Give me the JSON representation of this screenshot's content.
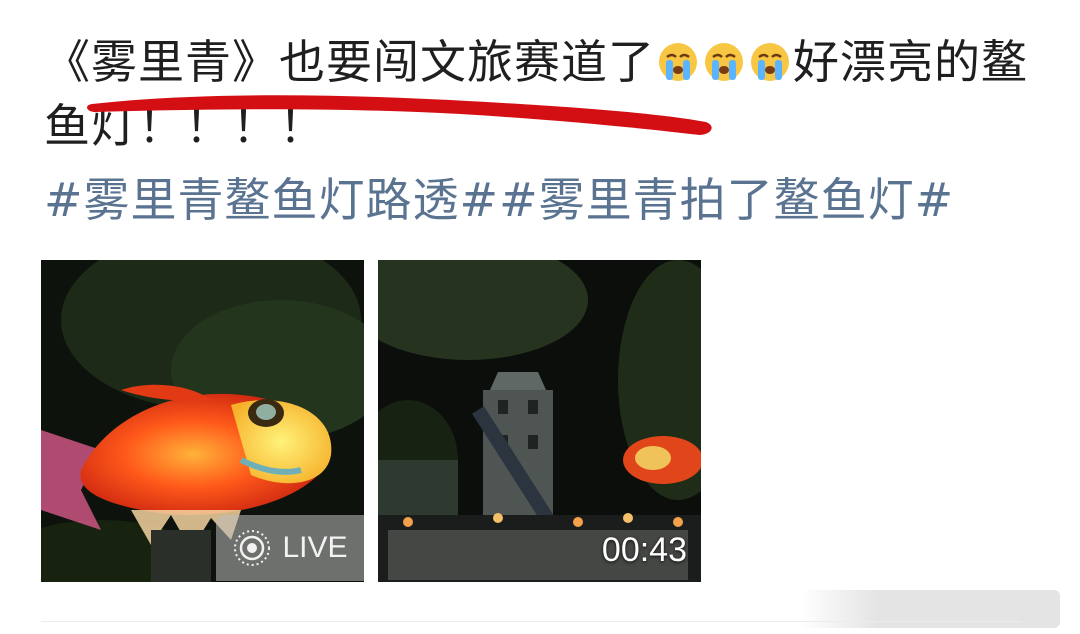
{
  "post": {
    "text_part1": "《雾里青》也要闯文旅赛道了",
    "emoji_icons": [
      "loudly-crying-face-icon",
      "loudly-crying-face-icon",
      "loudly-crying-face-icon"
    ],
    "text_part2": "好漂亮的鳌鱼灯！！！！"
  },
  "hashtags": [
    "#雾里青鳌鱼灯路透#",
    "#雾里青拍了鳌鱼灯#"
  ],
  "media": [
    {
      "type": "live-photo",
      "badge_icon": "live-photo-icon",
      "badge_label": "LIVE"
    },
    {
      "type": "video",
      "duration": "00:43"
    }
  ],
  "colors": {
    "text": "#1f1f1f",
    "hashtag": "#5a7391",
    "annotation_stroke": "#d40f14"
  }
}
